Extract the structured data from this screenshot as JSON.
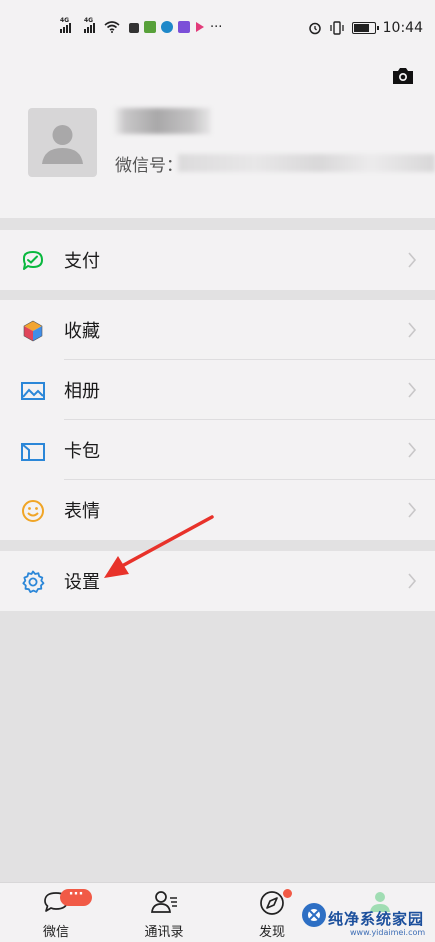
{
  "status_bar": {
    "network_left": "4G",
    "network_right": "4G",
    "time": "10:44"
  },
  "profile": {
    "wechat_id_label": "微信号："
  },
  "menu": {
    "pay": "支付",
    "favorites": "收藏",
    "album": "相册",
    "cards": "卡包",
    "stickers": "表情",
    "settings": "设置"
  },
  "tabs": {
    "chats": "微信",
    "contacts": "通讯录",
    "discover": "发现",
    "chats_badge": "···"
  },
  "watermark": {
    "brand": "纯净系统家园",
    "url": "www.yidaimei.com"
  },
  "colors": {
    "accent_green": "#09b83e",
    "badge_red": "#f15a46",
    "arrow_red": "#e8322a"
  }
}
